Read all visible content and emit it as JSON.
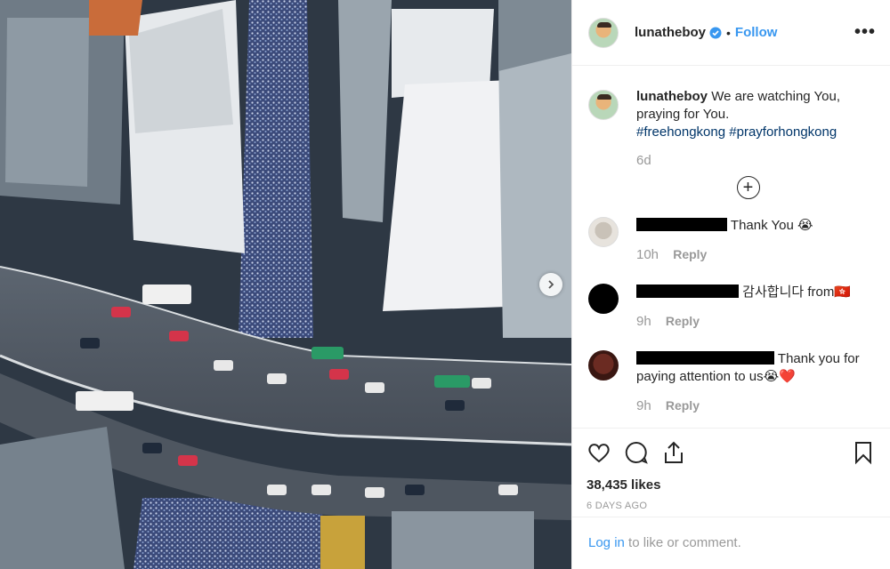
{
  "header": {
    "username": "lunatheboy",
    "separator": "•",
    "follow_label": "Follow",
    "more_label": "•••"
  },
  "caption": {
    "username": "lunatheboy",
    "text": "We are watching You, praying for You.",
    "hashtag1": "#freehongkong",
    "hashtag2": "#prayforhongkong",
    "time": "6d"
  },
  "comments": [
    {
      "text": "Thank You 😭",
      "time": "10h",
      "reply": "Reply"
    },
    {
      "text": "감사합니다 from🇭🇰",
      "time": "9h",
      "reply": "Reply"
    },
    {
      "text": "Thank you for paying attention to us😭❤️",
      "time": "9h",
      "reply": "Reply"
    }
  ],
  "actions": {
    "likes": "38,435 likes",
    "date": "6 DAYS AGO"
  },
  "login": {
    "link": "Log in",
    "rest": " to like or comment."
  },
  "icons": [
    "verified-badge-icon",
    "more-options-icon",
    "add-comment-icon",
    "heart-icon",
    "comment-icon",
    "share-icon",
    "bookmark-icon",
    "next-arrow-icon"
  ],
  "colors": {
    "link_blue": "#3897f0",
    "hashtag": "#003569",
    "muted": "#999999"
  }
}
